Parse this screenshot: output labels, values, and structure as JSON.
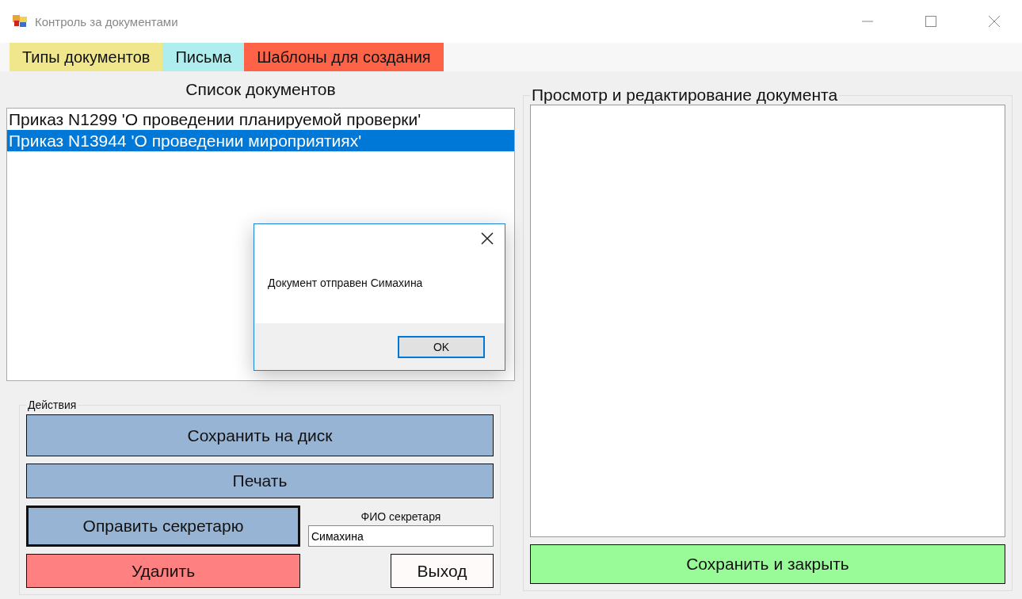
{
  "window": {
    "title": "Контроль за документами"
  },
  "menu": [
    {
      "label": "Типы документов",
      "color": "#f0e68c"
    },
    {
      "label": "Письма",
      "color": "#afeeee"
    },
    {
      "label": "Шаблоны для создания",
      "color": "#ff6347"
    }
  ],
  "document_list": {
    "title": "Список документов",
    "items": [
      {
        "label": "Приказ N1299 'О проведении планируемой проверки'",
        "selected": false
      },
      {
        "label": "Приказ N13944 'О проведении мироприятиях'",
        "selected": true
      }
    ]
  },
  "actions": {
    "title": "Действия",
    "save_button": "Сохранить на диск",
    "print_button": "Печать",
    "send_button": {
      "label": "Оправить секретарю",
      "focused": true
    },
    "secretary": {
      "label": "ФИО секретаря",
      "value": "Симахина"
    },
    "delete_button": "Удалить",
    "exit_button": "Выход"
  },
  "editor": {
    "title": "Просмотр и редактирование документа",
    "save_close_button": "Сохранить и закрыть"
  },
  "dialog": {
    "message": "Документ отправен Симахина",
    "ok_button": "OK"
  }
}
